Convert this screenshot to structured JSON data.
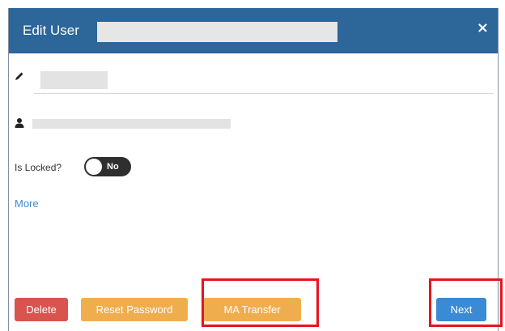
{
  "dialog": {
    "title": "Edit User",
    "close_label": "×"
  },
  "form": {
    "is_locked_label": "Is Locked?",
    "is_locked_toggle": {
      "state_text": "No",
      "on": false
    },
    "more_link": "More"
  },
  "footer": {
    "delete_label": "Delete",
    "reset_password_label": "Reset Password",
    "ma_transfer_label": "MA Transfer",
    "next_label": "Next"
  },
  "colors": {
    "header": "#2d6699",
    "danger": "#d9534f",
    "warning": "#f0ad4e",
    "primary": "#3b8ad6",
    "highlight": "#e6141e"
  },
  "icons": {
    "name_field": "pencil-icon",
    "user_field": "user-icon"
  }
}
